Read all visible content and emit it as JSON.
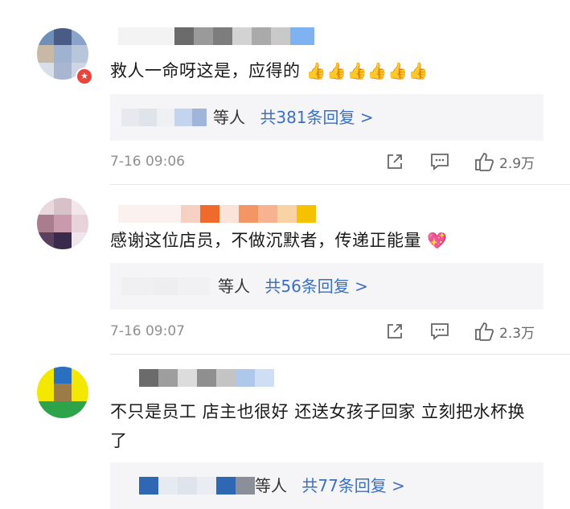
{
  "comments": [
    {
      "text": "救人一命呀这是，应得的",
      "emoji": "👍👍👍👍👍👍",
      "reply_prefix": "等人",
      "reply_link": "共381条回复 >",
      "time": "7-16 09:06",
      "likes": "2.9万",
      "has_badge": true
    },
    {
      "text": "感谢这位店员，不做沉默者，传递正能量",
      "emoji": "💖",
      "reply_prefix": "等人",
      "reply_link": "共56条回复 >",
      "time": "7-16 09:07",
      "likes": "2.3万",
      "has_badge": false
    },
    {
      "text": "不只是员工 店主也很好 还送女孩子回家 立刻把水杯换了",
      "emoji": "",
      "reply_prefix": "等人",
      "reply_link": "共77条回复 >",
      "time": "",
      "likes": "",
      "has_badge": false
    }
  ],
  "icons": {
    "share": "share-icon",
    "comment": "comment-icon",
    "like": "thumbs-up-icon",
    "badge": "star-badge-icon"
  },
  "colors": {
    "link": "#3b6fc2",
    "reply_bg": "#f5f5f7",
    "meta": "#8f8f8f"
  }
}
